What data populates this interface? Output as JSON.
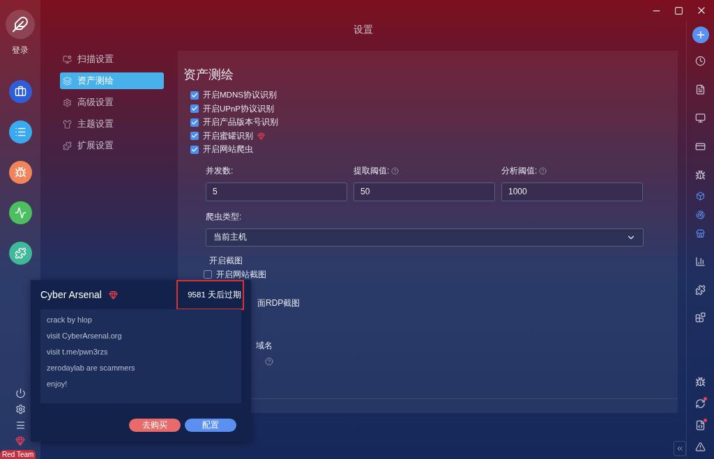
{
  "window": {
    "title": "设置"
  },
  "left_rail": {
    "login": "登录",
    "badge": "Red Team"
  },
  "nav": [
    {
      "label": "扫描设置",
      "selected": false,
      "kind": "scan"
    },
    {
      "label": "资产测绘",
      "selected": true,
      "kind": "layers"
    },
    {
      "label": "高级设置",
      "selected": false,
      "kind": "gear"
    },
    {
      "label": "主题设置",
      "selected": false,
      "kind": "shirt"
    },
    {
      "label": "扩展设置",
      "selected": false,
      "kind": "puzzle"
    }
  ],
  "section": {
    "title": "资产测绘",
    "checkboxes": [
      {
        "label": "开启MDNS协议识别",
        "checked": true,
        "premium": false
      },
      {
        "label": "开启UPnP协议识别",
        "checked": true,
        "premium": false
      },
      {
        "label": "开启产品版本号识别",
        "checked": true,
        "premium": false
      },
      {
        "label": "开启蜜罐识别",
        "checked": true,
        "premium": true
      },
      {
        "label": "开启网站爬虫",
        "checked": true,
        "premium": false
      }
    ],
    "fields": [
      {
        "label": "并发数:",
        "value": "5",
        "help": false
      },
      {
        "label": "提取阈值:",
        "value": "50",
        "help": true
      },
      {
        "label": "分析阈值:",
        "value": "1000",
        "help": true
      }
    ],
    "crawler": {
      "label": "爬虫类型:",
      "value": "当前主机"
    },
    "screenshot": {
      "title": "开启截图",
      "options": [
        {
          "label": "开启网站截图",
          "checked": false
        }
      ],
      "covered_texts": [
        "面RDP截图",
        "域名"
      ]
    }
  },
  "popup": {
    "title": "Cyber Arsenal",
    "expiry": "9581 天后过期",
    "lines": [
      "crack by hlop",
      "visit CyberArsenal.org",
      "visit t.me/pwn3rzs",
      "zerodaylab are scammers",
      "enjoy!"
    ],
    "buttons": [
      {
        "label": "去购买",
        "kind": "buy"
      },
      {
        "label": "配置",
        "kind": "primary"
      }
    ]
  }
}
